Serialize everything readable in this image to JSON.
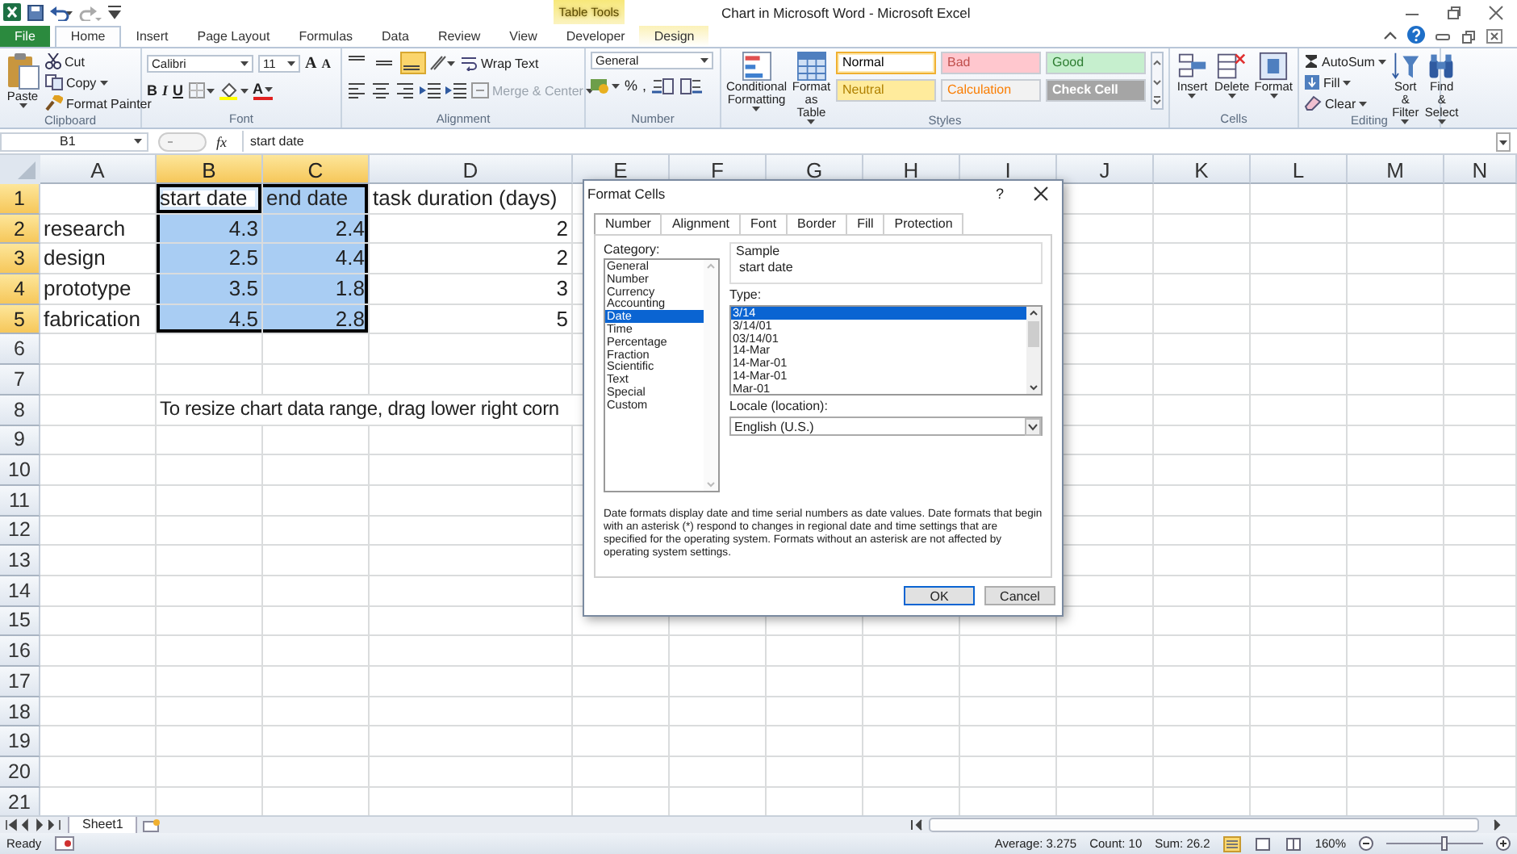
{
  "window": {
    "title": "Chart in Microsoft Word - Microsoft Excel",
    "contextual_group": "Table Tools"
  },
  "ribbon_tabs": [
    {
      "label": "File",
      "kind": "file",
      "selected": false
    },
    {
      "label": "Home",
      "kind": "normal",
      "selected": true
    },
    {
      "label": "Insert",
      "kind": "normal",
      "selected": false
    },
    {
      "label": "Page Layout",
      "kind": "normal",
      "selected": false
    },
    {
      "label": "Formulas",
      "kind": "normal",
      "selected": false
    },
    {
      "label": "Data",
      "kind": "normal",
      "selected": false
    },
    {
      "label": "Review",
      "kind": "normal",
      "selected": false
    },
    {
      "label": "View",
      "kind": "normal",
      "selected": false
    },
    {
      "label": "Developer",
      "kind": "normal",
      "selected": false
    },
    {
      "label": "Design",
      "kind": "contextual",
      "selected": false
    }
  ],
  "clipboard": {
    "label": "Clipboard",
    "paste": "Paste",
    "cut": "Cut",
    "copy": "Copy",
    "format_painter": "Format Painter"
  },
  "font": {
    "label": "Font",
    "name": "Calibri",
    "size": "11",
    "grow": "A",
    "shrink": "A",
    "bold": "B",
    "italic": "I",
    "underline": "U",
    "color_button": "A"
  },
  "alignment": {
    "label": "Alignment",
    "wrap_text": "Wrap Text",
    "merge_center": "Merge & Center",
    "merge_disabled": true,
    "vertical": [
      {
        "selected": false
      },
      {
        "selected": false
      },
      {
        "selected": true
      }
    ]
  },
  "number": {
    "label": "Number",
    "format": "General",
    "percent": "%",
    "comma": ","
  },
  "styles": {
    "label": "Styles",
    "conditional": "Conditional Formatting",
    "format_table": "Format as Table",
    "gallery": [
      {
        "label": "Normal",
        "color": "#ffffff",
        "selected": true
      },
      {
        "label": "Bad",
        "color": "#ffc7ce",
        "selected": false
      },
      {
        "label": "Good",
        "color": "#c6efce",
        "selected": false
      },
      {
        "label": "Neutral",
        "color": "#ffeb9c",
        "selected": false
      },
      {
        "label": "Calculation",
        "color": "#f2f2f2",
        "selected": false
      },
      {
        "label": "Check Cell",
        "color": "#a5a5a5",
        "selected": false
      }
    ]
  },
  "cells_group": {
    "label": "Cells",
    "insert": "Insert",
    "delete": "Delete",
    "format": "Format"
  },
  "editing": {
    "label": "Editing",
    "autosum": "AutoSum",
    "fill": "Fill",
    "clear": "Clear",
    "sort_filter": "Sort & Filter",
    "find_select": "Find & Select"
  },
  "formula_bar": {
    "name_box": "B1",
    "fx": "fx",
    "value": "start date"
  },
  "sheet": {
    "columns": [
      {
        "label": "A",
        "selected": false
      },
      {
        "label": "B",
        "selected": true
      },
      {
        "label": "C",
        "selected": true
      },
      {
        "label": "D",
        "selected": false
      },
      {
        "label": "E",
        "selected": false
      },
      {
        "label": "F",
        "selected": false
      },
      {
        "label": "G",
        "selected": false
      },
      {
        "label": "H",
        "selected": false
      },
      {
        "label": "I",
        "selected": false
      },
      {
        "label": "J",
        "selected": false
      },
      {
        "label": "K",
        "selected": false
      },
      {
        "label": "L",
        "selected": false
      },
      {
        "label": "M",
        "selected": false
      },
      {
        "label": "N",
        "selected": false
      }
    ],
    "rows": [
      {
        "label": "1",
        "selected": true,
        "cells": [
          {
            "text": "",
            "kind": "text",
            "selected": false,
            "active": false
          },
          {
            "text": "start date",
            "kind": "text",
            "selected": true,
            "active": true
          },
          {
            "text": "end date",
            "kind": "text",
            "selected": true,
            "active": false
          },
          {
            "text": "task duration (days)",
            "kind": "text",
            "selected": false,
            "active": false
          }
        ]
      },
      {
        "label": "2",
        "selected": true,
        "cells": [
          {
            "text": "research",
            "kind": "text",
            "selected": false,
            "active": false
          },
          {
            "text": "4.3",
            "kind": "number",
            "selected": true,
            "active": false
          },
          {
            "text": "2.4",
            "kind": "number",
            "selected": true,
            "active": false
          },
          {
            "text": "2",
            "kind": "number",
            "selected": false,
            "active": false
          }
        ]
      },
      {
        "label": "3",
        "selected": true,
        "cells": [
          {
            "text": "design",
            "kind": "text",
            "selected": false,
            "active": false
          },
          {
            "text": "2.5",
            "kind": "number",
            "selected": true,
            "active": false
          },
          {
            "text": "4.4",
            "kind": "number",
            "selected": true,
            "active": false
          },
          {
            "text": "2",
            "kind": "number",
            "selected": false,
            "active": false
          }
        ]
      },
      {
        "label": "4",
        "selected": true,
        "cells": [
          {
            "text": "prototype",
            "kind": "text",
            "selected": false,
            "active": false
          },
          {
            "text": "3.5",
            "kind": "number",
            "selected": true,
            "active": false
          },
          {
            "text": "1.8",
            "kind": "number",
            "selected": true,
            "active": false
          },
          {
            "text": "3",
            "kind": "number",
            "selected": false,
            "active": false
          }
        ]
      },
      {
        "label": "5",
        "selected": true,
        "cells": [
          {
            "text": "fabrication",
            "kind": "text",
            "selected": false,
            "active": false
          },
          {
            "text": "4.5",
            "kind": "number",
            "selected": true,
            "active": false
          },
          {
            "text": "2.8",
            "kind": "number",
            "selected": true,
            "active": false
          },
          {
            "text": "5",
            "kind": "number",
            "selected": false,
            "active": false
          }
        ]
      },
      {
        "label": "6",
        "selected": false,
        "cells": []
      },
      {
        "label": "7",
        "selected": false,
        "cells": []
      },
      {
        "label": "8",
        "selected": false,
        "cells": [
          {
            "text": "",
            "kind": "text",
            "selected": false,
            "active": false
          },
          {
            "text": "To resize chart data range, drag lower right corn",
            "kind": "text",
            "selected": false,
            "active": false
          }
        ]
      },
      {
        "label": "9",
        "selected": false,
        "cells": []
      },
      {
        "label": "10",
        "selected": false,
        "cells": []
      },
      {
        "label": "11",
        "selected": false,
        "cells": []
      },
      {
        "label": "12",
        "selected": false,
        "cells": []
      },
      {
        "label": "13",
        "selected": false,
        "cells": []
      },
      {
        "label": "14",
        "selected": false,
        "cells": []
      },
      {
        "label": "15",
        "selected": false,
        "cells": []
      },
      {
        "label": "16",
        "selected": false,
        "cells": []
      },
      {
        "label": "17",
        "selected": false,
        "cells": []
      },
      {
        "label": "18",
        "selected": false,
        "cells": []
      },
      {
        "label": "19",
        "selected": false,
        "cells": []
      },
      {
        "label": "20",
        "selected": false,
        "cells": []
      },
      {
        "label": "21",
        "selected": false,
        "cells": []
      }
    ]
  },
  "dialog": {
    "title": "Format Cells",
    "help": "?",
    "tabs": [
      {
        "label": "Number",
        "selected": true
      },
      {
        "label": "Alignment",
        "selected": false
      },
      {
        "label": "Font",
        "selected": false
      },
      {
        "label": "Border",
        "selected": false
      },
      {
        "label": "Fill",
        "selected": false
      },
      {
        "label": "Protection",
        "selected": false
      }
    ],
    "category_label": "Category:",
    "categories": [
      {
        "label": "General",
        "selected": false
      },
      {
        "label": "Number",
        "selected": false
      },
      {
        "label": "Currency",
        "selected": false
      },
      {
        "label": "Accounting",
        "selected": false
      },
      {
        "label": "Date",
        "selected": true
      },
      {
        "label": "Time",
        "selected": false
      },
      {
        "label": "Percentage",
        "selected": false
      },
      {
        "label": "Fraction",
        "selected": false
      },
      {
        "label": "Scientific",
        "selected": false
      },
      {
        "label": "Text",
        "selected": false
      },
      {
        "label": "Special",
        "selected": false
      },
      {
        "label": "Custom",
        "selected": false
      }
    ],
    "sample_label": "Sample",
    "sample": "start date",
    "type_label": "Type:",
    "types": [
      {
        "label": "3/14",
        "selected": true
      },
      {
        "label": "3/14/01",
        "selected": false
      },
      {
        "label": "03/14/01",
        "selected": false
      },
      {
        "label": "14-Mar",
        "selected": false
      },
      {
        "label": "14-Mar-01",
        "selected": false
      },
      {
        "label": "14-Mar-01",
        "selected": false
      },
      {
        "label": "Mar-01",
        "selected": false
      }
    ],
    "locale_label": "Locale (location):",
    "locale": "English (U.S.)",
    "description": "Date formats display date and time serial numbers as date values.  Date formats that begin with an asterisk (*) respond to changes in regional date and time settings that are specified for the operating system. Formats without an asterisk are not affected by operating system settings.",
    "buttons": [
      {
        "label": "OK",
        "kind": "default"
      },
      {
        "label": "Cancel",
        "kind": "normal"
      }
    ]
  },
  "sheet_tabs": [
    {
      "label": "Sheet1",
      "selected": true
    }
  ],
  "status_bar": {
    "mode": "Ready",
    "average": "Average: 3.275",
    "count": "Count: 10",
    "sum": "Sum: 26.2",
    "zoom": "160%",
    "zoom_slider": {
      "level": 0.6
    }
  }
}
